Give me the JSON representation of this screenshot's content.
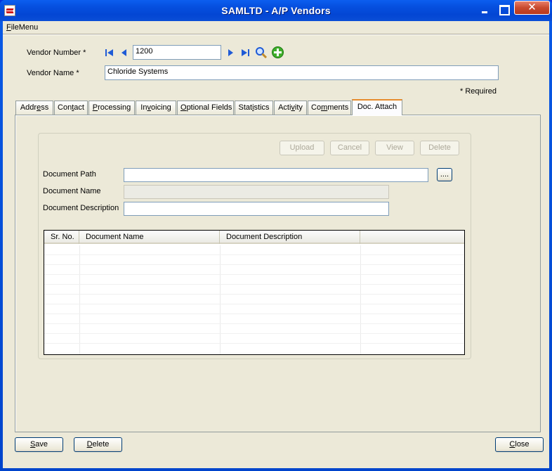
{
  "window": {
    "title": "SAMLTD - A/P Vendors",
    "close_glyph": "✕"
  },
  "menubar": {
    "file_menu_accel": "F",
    "file_menu_rest": "ileMenu"
  },
  "header": {
    "vendor_number_label": "Vendor Number *",
    "vendor_number_value": "1200",
    "vendor_name_label": "Vendor Name *",
    "vendor_name_value": "Chloride Systems",
    "required_note": "* Required"
  },
  "tabs": [
    {
      "pre": "Addr",
      "ul": "e",
      "post": "ss"
    },
    {
      "pre": "Con",
      "ul": "t",
      "post": "act"
    },
    {
      "pre": "",
      "ul": "P",
      "post": "rocessing"
    },
    {
      "pre": "In",
      "ul": "v",
      "post": "oicing"
    },
    {
      "pre": "",
      "ul": "O",
      "post": "ptional Fields"
    },
    {
      "pre": "Stat",
      "ul": "i",
      "post": "stics"
    },
    {
      "pre": "Acti",
      "ul": "v",
      "post": "ity"
    },
    {
      "pre": "Co",
      "ul": "m",
      "post": "ments"
    },
    {
      "pre": "Doc. Attach",
      "ul": "",
      "post": ""
    }
  ],
  "doc_attach": {
    "upload_label": "Upload",
    "cancel_label": "Cancel",
    "view_label": "View",
    "delete_label": "Delete",
    "document_path_label": "Document Path",
    "document_path_value": "",
    "browse_label": "....",
    "document_name_label": "Document Name",
    "document_name_value": "",
    "document_description_label": "Document Description",
    "document_description_value": "",
    "grid_columns": [
      "Sr. No.",
      "Document Name",
      "Document Description"
    ]
  },
  "footer": {
    "save_accel": "S",
    "save_rest": "ave",
    "delete_accel": "D",
    "delete_rest": "elete",
    "close_accel": "C",
    "close_rest": "lose"
  }
}
